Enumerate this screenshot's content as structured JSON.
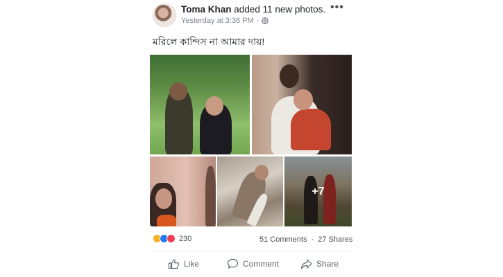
{
  "post": {
    "author": "Toma Khan",
    "action": "added 11 new photos.",
    "timestamp": "Yesterday at 3:36 PM",
    "meta_sep": "·",
    "caption": "মরিলে কান্দিস না আমার দায়!",
    "more_photos": "+7",
    "reaction_count": "230",
    "comments": "51 Comments",
    "stats_sep": "·",
    "shares": "27 Shares",
    "actions": {
      "like": "Like",
      "comment": "Comment",
      "share": "Share"
    },
    "icons": [
      "more-icon",
      "globe-icon",
      "sad-icon",
      "like-icon",
      "love-icon",
      "thumb-icon",
      "comment-icon",
      "share-icon"
    ]
  },
  "colors": {
    "like": "#2078f4",
    "love": "#f33e58",
    "sad": "#f7b125",
    "meta_text": "#7f858f"
  }
}
